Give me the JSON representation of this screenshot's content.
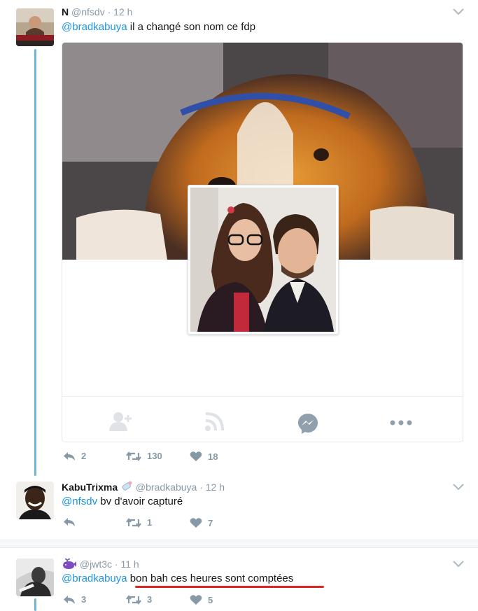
{
  "tweets": [
    {
      "name": "N",
      "handle": "@nfsdv",
      "dot": "·",
      "time": "12 h",
      "mention": "@bradkabuya",
      "text": " il a changé son nom ce fdp",
      "replies": "2",
      "retweets": "130",
      "likes": "18"
    },
    {
      "name": "KabuTrixma",
      "handle": "@bradkabuya",
      "dot": "·",
      "time": "12 h",
      "mention": "@nfsdv",
      "text": " bv d'avoir capturé",
      "replies": "",
      "retweets": "1",
      "likes": "7"
    },
    {
      "name": "",
      "handle": "@jwt3c",
      "dot": "·",
      "time": "11 h",
      "mention": "@bradkabuya",
      "text": " bon bah ces heures sont comptées",
      "replies": "3",
      "retweets": "3",
      "likes": "5"
    }
  ],
  "colors": {
    "thread_line": "#6eb6dd",
    "mention": "#1b95e0",
    "meta": "#8899a6",
    "highlight_underline": "#e02424"
  },
  "icons": [
    "reply-icon",
    "retweet-icon",
    "like-icon",
    "chevron-down-icon",
    "add-friend-icon",
    "rss-icon",
    "messenger-icon",
    "more-icon",
    "whale-emoji-icon",
    "baby-bottle-emoji-icon"
  ]
}
